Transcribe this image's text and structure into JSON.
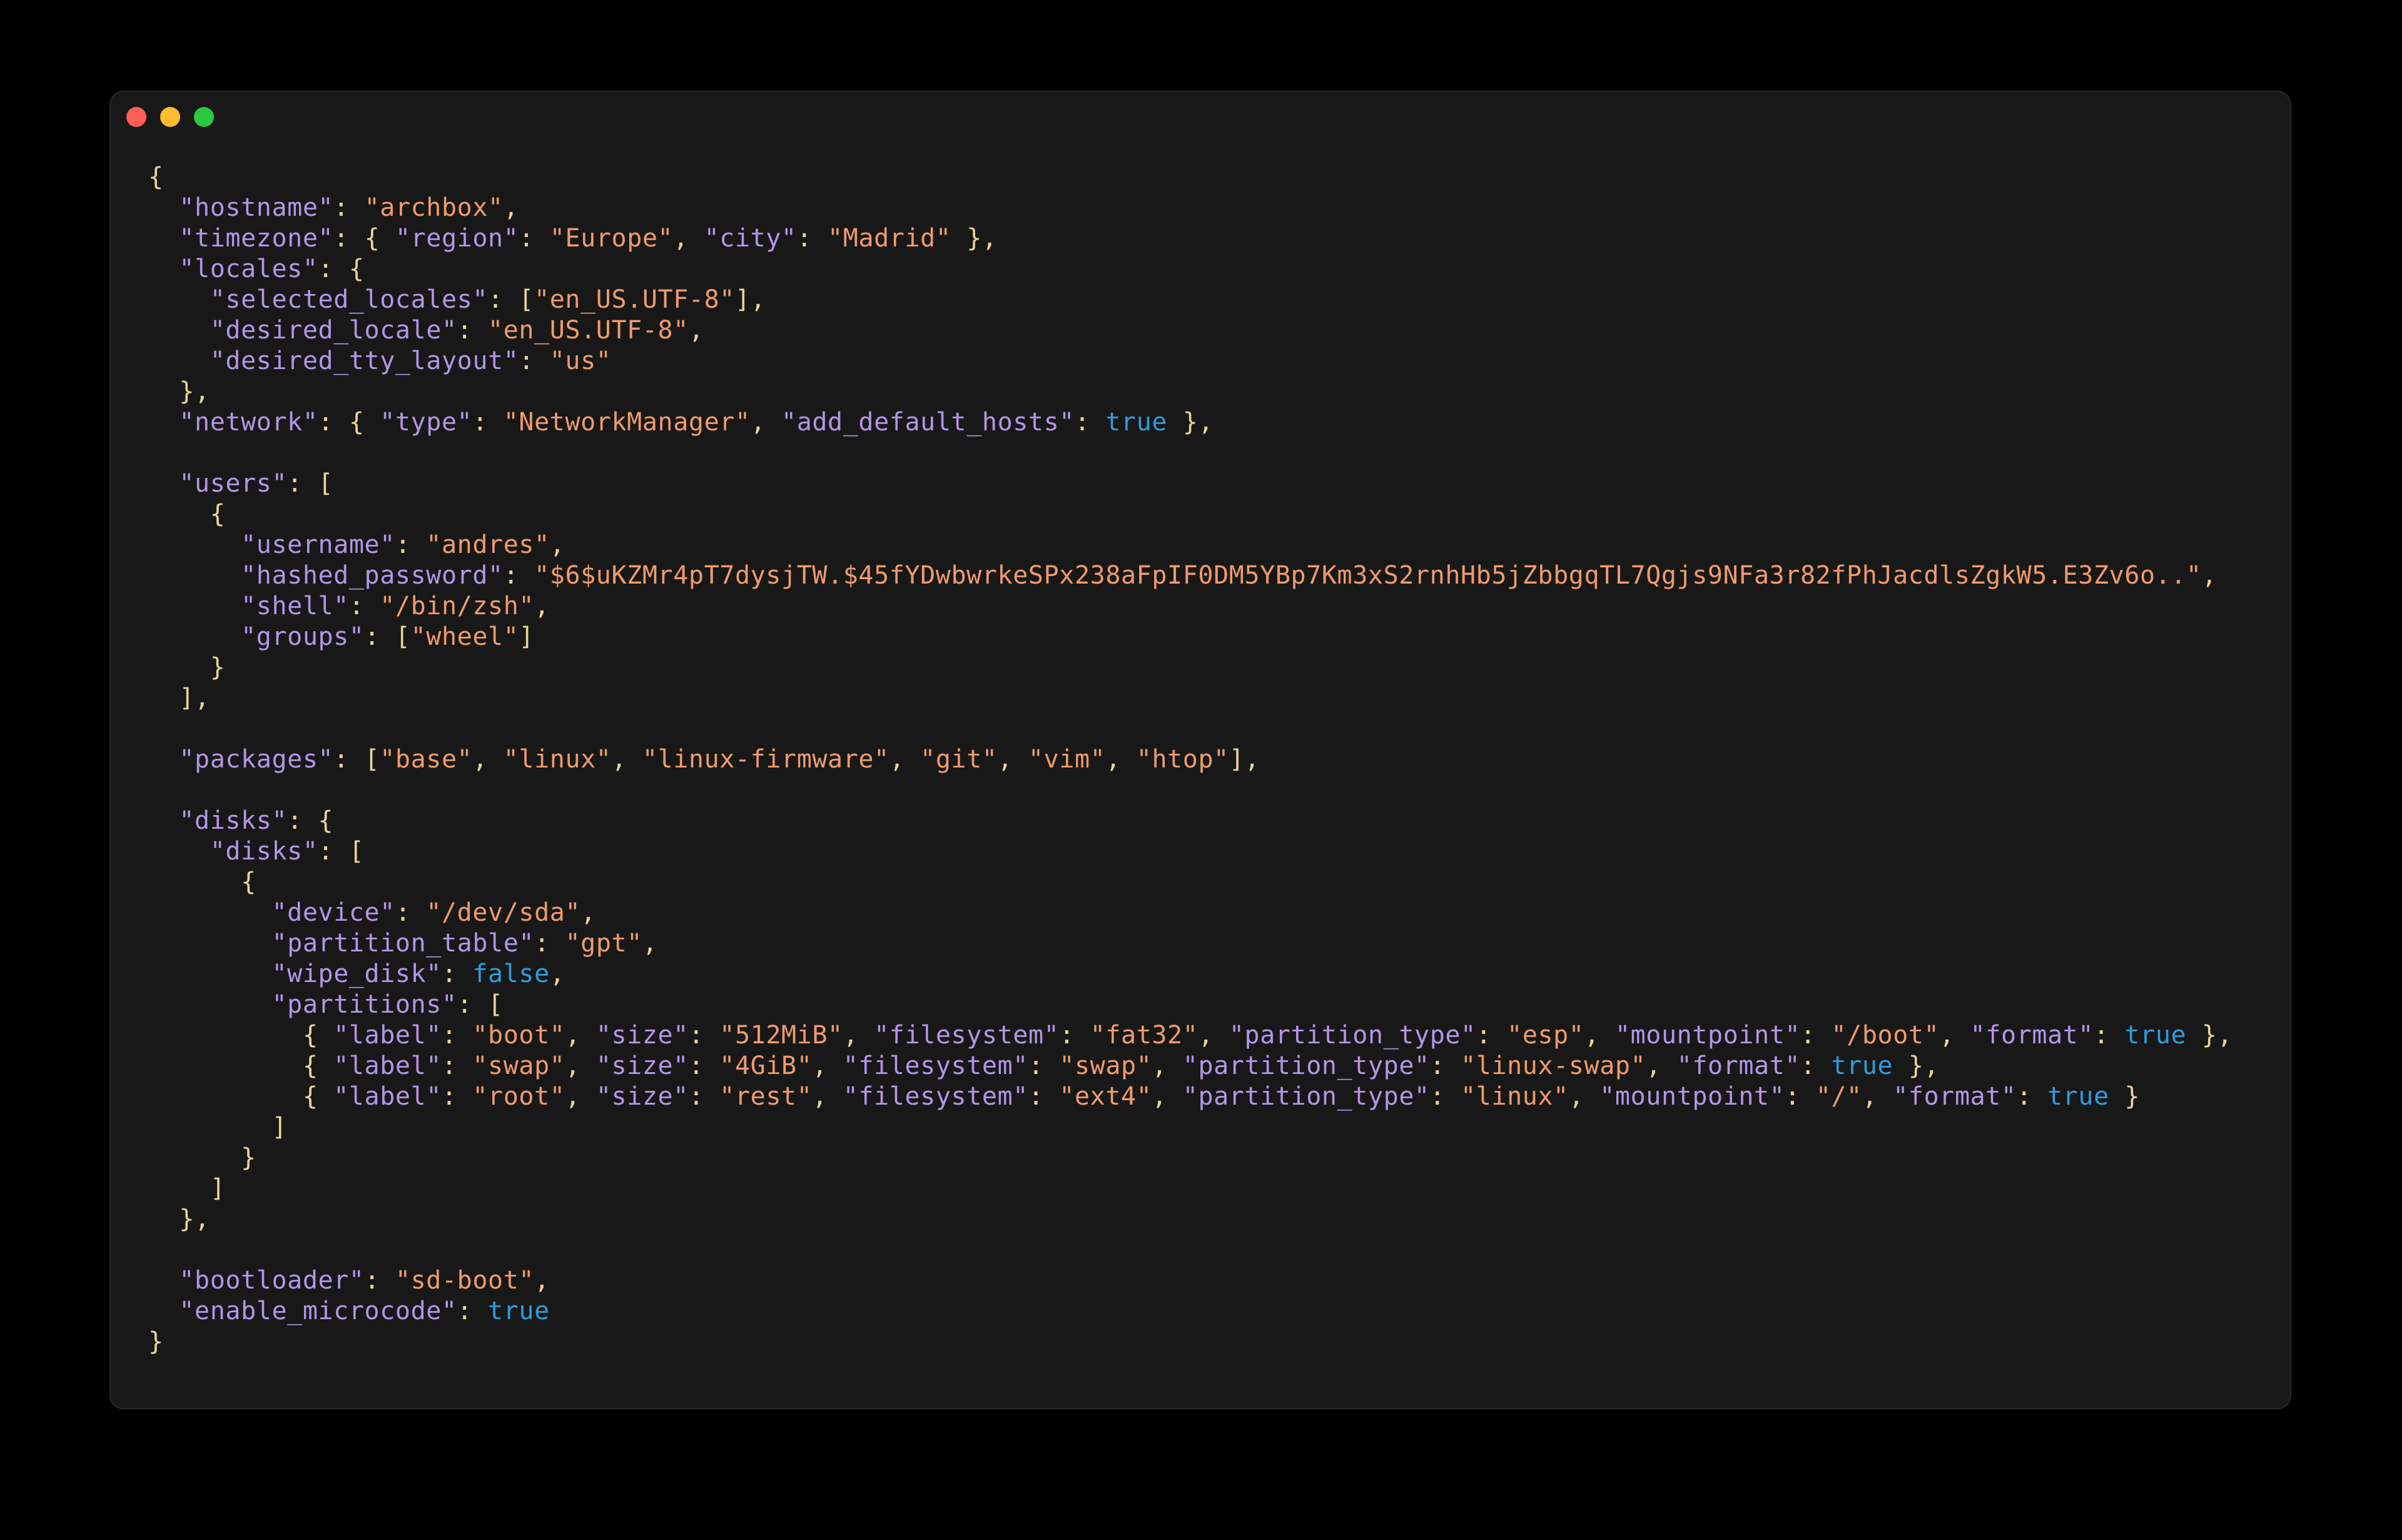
{
  "window": {
    "controls": [
      "close",
      "minimize",
      "maximize"
    ],
    "colors": {
      "close": "#ff5f57",
      "minimize": "#febc2e",
      "maximize": "#28c840"
    }
  },
  "syntax_colors": {
    "key": "#b296e6",
    "string": "#ef9b6c",
    "boolean": "#2f9cdc",
    "punctuation": "#e9d49a",
    "background": "#181818"
  },
  "code_lines": [
    [
      [
        "p",
        "{"
      ]
    ],
    [
      [
        "p",
        "  "
      ],
      [
        "k",
        "\"hostname\""
      ],
      [
        "p",
        ": "
      ],
      [
        "s",
        "\"archbox\""
      ],
      [
        "p",
        ","
      ]
    ],
    [
      [
        "p",
        "  "
      ],
      [
        "k",
        "\"timezone\""
      ],
      [
        "p",
        ": { "
      ],
      [
        "k",
        "\"region\""
      ],
      [
        "p",
        ": "
      ],
      [
        "s",
        "\"Europe\""
      ],
      [
        "p",
        ", "
      ],
      [
        "k",
        "\"city\""
      ],
      [
        "p",
        ": "
      ],
      [
        "s",
        "\"Madrid\""
      ],
      [
        "p",
        " },"
      ]
    ],
    [
      [
        "p",
        "  "
      ],
      [
        "k",
        "\"locales\""
      ],
      [
        "p",
        ": {"
      ]
    ],
    [
      [
        "p",
        "    "
      ],
      [
        "k",
        "\"selected_locales\""
      ],
      [
        "p",
        ": ["
      ],
      [
        "s",
        "\"en_US.UTF-8\""
      ],
      [
        "p",
        "],"
      ]
    ],
    [
      [
        "p",
        "    "
      ],
      [
        "k",
        "\"desired_locale\""
      ],
      [
        "p",
        ": "
      ],
      [
        "s",
        "\"en_US.UTF-8\""
      ],
      [
        "p",
        ","
      ]
    ],
    [
      [
        "p",
        "    "
      ],
      [
        "k",
        "\"desired_tty_layout\""
      ],
      [
        "p",
        ": "
      ],
      [
        "s",
        "\"us\""
      ]
    ],
    [
      [
        "p",
        "  },"
      ]
    ],
    [
      [
        "p",
        "  "
      ],
      [
        "k",
        "\"network\""
      ],
      [
        "p",
        ": { "
      ],
      [
        "k",
        "\"type\""
      ],
      [
        "p",
        ": "
      ],
      [
        "s",
        "\"NetworkManager\""
      ],
      [
        "p",
        ", "
      ],
      [
        "k",
        "\"add_default_hosts\""
      ],
      [
        "p",
        ": "
      ],
      [
        "b",
        "true"
      ],
      [
        "p",
        " },"
      ]
    ],
    [],
    [
      [
        "p",
        "  "
      ],
      [
        "k",
        "\"users\""
      ],
      [
        "p",
        ": ["
      ]
    ],
    [
      [
        "p",
        "    {"
      ]
    ],
    [
      [
        "p",
        "      "
      ],
      [
        "k",
        "\"username\""
      ],
      [
        "p",
        ": "
      ],
      [
        "s",
        "\"andres\""
      ],
      [
        "p",
        ","
      ]
    ],
    [
      [
        "p",
        "      "
      ],
      [
        "k",
        "\"hashed_password\""
      ],
      [
        "p",
        ": "
      ],
      [
        "s",
        "\"$6$uKZMr4pT7dysjTW.$45fYDwbwrkeSPx238aFpIF0DM5YBp7Km3xS2rnhHb5jZbbgqTL7Qgjs9NFa3r82fPhJacdlsZgkW5.E3Zv6o..\""
      ],
      [
        "p",
        ","
      ]
    ],
    [
      [
        "p",
        "      "
      ],
      [
        "k",
        "\"shell\""
      ],
      [
        "p",
        ": "
      ],
      [
        "s",
        "\"/bin/zsh\""
      ],
      [
        "p",
        ","
      ]
    ],
    [
      [
        "p",
        "      "
      ],
      [
        "k",
        "\"groups\""
      ],
      [
        "p",
        ": ["
      ],
      [
        "s",
        "\"wheel\""
      ],
      [
        "p",
        "]"
      ]
    ],
    [
      [
        "p",
        "    }"
      ]
    ],
    [
      [
        "p",
        "  ],"
      ]
    ],
    [],
    [
      [
        "p",
        "  "
      ],
      [
        "k",
        "\"packages\""
      ],
      [
        "p",
        ": ["
      ],
      [
        "s",
        "\"base\""
      ],
      [
        "p",
        ", "
      ],
      [
        "s",
        "\"linux\""
      ],
      [
        "p",
        ", "
      ],
      [
        "s",
        "\"linux-firmware\""
      ],
      [
        "p",
        ", "
      ],
      [
        "s",
        "\"git\""
      ],
      [
        "p",
        ", "
      ],
      [
        "s",
        "\"vim\""
      ],
      [
        "p",
        ", "
      ],
      [
        "s",
        "\"htop\""
      ],
      [
        "p",
        "],"
      ]
    ],
    [],
    [
      [
        "p",
        "  "
      ],
      [
        "k",
        "\"disks\""
      ],
      [
        "p",
        ": {"
      ]
    ],
    [
      [
        "p",
        "    "
      ],
      [
        "k",
        "\"disks\""
      ],
      [
        "p",
        ": ["
      ]
    ],
    [
      [
        "p",
        "      {"
      ]
    ],
    [
      [
        "p",
        "        "
      ],
      [
        "k",
        "\"device\""
      ],
      [
        "p",
        ": "
      ],
      [
        "s",
        "\"/dev/sda\""
      ],
      [
        "p",
        ","
      ]
    ],
    [
      [
        "p",
        "        "
      ],
      [
        "k",
        "\"partition_table\""
      ],
      [
        "p",
        ": "
      ],
      [
        "s",
        "\"gpt\""
      ],
      [
        "p",
        ","
      ]
    ],
    [
      [
        "p",
        "        "
      ],
      [
        "k",
        "\"wipe_disk\""
      ],
      [
        "p",
        ": "
      ],
      [
        "b",
        "false"
      ],
      [
        "p",
        ","
      ]
    ],
    [
      [
        "p",
        "        "
      ],
      [
        "k",
        "\"partitions\""
      ],
      [
        "p",
        ": ["
      ]
    ],
    [
      [
        "p",
        "          { "
      ],
      [
        "k",
        "\"label\""
      ],
      [
        "p",
        ": "
      ],
      [
        "s",
        "\"boot\""
      ],
      [
        "p",
        ", "
      ],
      [
        "k",
        "\"size\""
      ],
      [
        "p",
        ": "
      ],
      [
        "s",
        "\"512MiB\""
      ],
      [
        "p",
        ", "
      ],
      [
        "k",
        "\"filesystem\""
      ],
      [
        "p",
        ": "
      ],
      [
        "s",
        "\"fat32\""
      ],
      [
        "p",
        ", "
      ],
      [
        "k",
        "\"partition_type\""
      ],
      [
        "p",
        ": "
      ],
      [
        "s",
        "\"esp\""
      ],
      [
        "p",
        ", "
      ],
      [
        "k",
        "\"mountpoint\""
      ],
      [
        "p",
        ": "
      ],
      [
        "s",
        "\"/boot\""
      ],
      [
        "p",
        ", "
      ],
      [
        "k",
        "\"format\""
      ],
      [
        "p",
        ": "
      ],
      [
        "b",
        "true"
      ],
      [
        "p",
        " },"
      ]
    ],
    [
      [
        "p",
        "          { "
      ],
      [
        "k",
        "\"label\""
      ],
      [
        "p",
        ": "
      ],
      [
        "s",
        "\"swap\""
      ],
      [
        "p",
        ", "
      ],
      [
        "k",
        "\"size\""
      ],
      [
        "p",
        ": "
      ],
      [
        "s",
        "\"4GiB\""
      ],
      [
        "p",
        ", "
      ],
      [
        "k",
        "\"filesystem\""
      ],
      [
        "p",
        ": "
      ],
      [
        "s",
        "\"swap\""
      ],
      [
        "p",
        ", "
      ],
      [
        "k",
        "\"partition_type\""
      ],
      [
        "p",
        ": "
      ],
      [
        "s",
        "\"linux-swap\""
      ],
      [
        "p",
        ", "
      ],
      [
        "k",
        "\"format\""
      ],
      [
        "p",
        ": "
      ],
      [
        "b",
        "true"
      ],
      [
        "p",
        " },"
      ]
    ],
    [
      [
        "p",
        "          { "
      ],
      [
        "k",
        "\"label\""
      ],
      [
        "p",
        ": "
      ],
      [
        "s",
        "\"root\""
      ],
      [
        "p",
        ", "
      ],
      [
        "k",
        "\"size\""
      ],
      [
        "p",
        ": "
      ],
      [
        "s",
        "\"rest\""
      ],
      [
        "p",
        ", "
      ],
      [
        "k",
        "\"filesystem\""
      ],
      [
        "p",
        ": "
      ],
      [
        "s",
        "\"ext4\""
      ],
      [
        "p",
        ", "
      ],
      [
        "k",
        "\"partition_type\""
      ],
      [
        "p",
        ": "
      ],
      [
        "s",
        "\"linux\""
      ],
      [
        "p",
        ", "
      ],
      [
        "k",
        "\"mountpoint\""
      ],
      [
        "p",
        ": "
      ],
      [
        "s",
        "\"/\""
      ],
      [
        "p",
        ", "
      ],
      [
        "k",
        "\"format\""
      ],
      [
        "p",
        ": "
      ],
      [
        "b",
        "true"
      ],
      [
        "p",
        " }"
      ]
    ],
    [
      [
        "p",
        "        ]"
      ]
    ],
    [
      [
        "p",
        "      }"
      ]
    ],
    [
      [
        "p",
        "    ]"
      ]
    ],
    [
      [
        "p",
        "  },"
      ]
    ],
    [],
    [
      [
        "p",
        "  "
      ],
      [
        "k",
        "\"bootloader\""
      ],
      [
        "p",
        ": "
      ],
      [
        "s",
        "\"sd-boot\""
      ],
      [
        "p",
        ","
      ]
    ],
    [
      [
        "p",
        "  "
      ],
      [
        "k",
        "\"enable_microcode\""
      ],
      [
        "p",
        ": "
      ],
      [
        "b",
        "true"
      ]
    ],
    [
      [
        "p",
        "}"
      ]
    ]
  ]
}
